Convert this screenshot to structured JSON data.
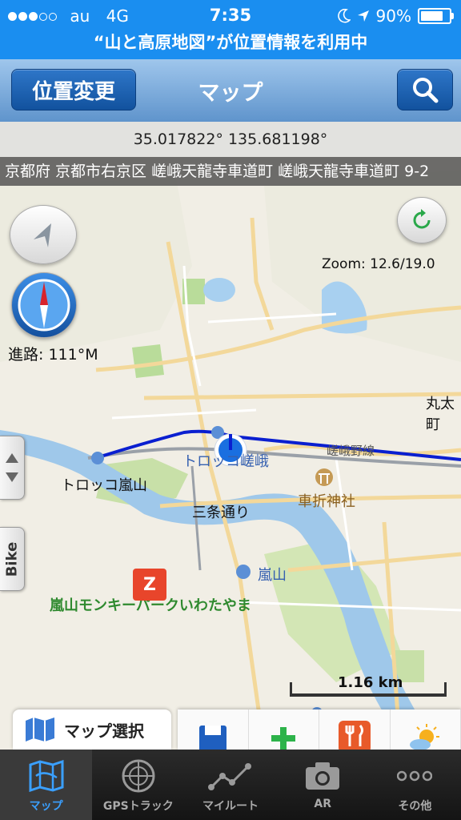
{
  "status": {
    "carrier": "au",
    "network": "4G",
    "time": "7:35",
    "battery": "90%",
    "battery_level": 0.9
  },
  "location_banner": "“山と高原地図”が位置情報を利用中",
  "navbar": {
    "left_button": "位置変更",
    "title": "マップ"
  },
  "map": {
    "coordinates": "35.017822° 135.681198°",
    "address": "京都府 京都市右京区 嵯峨天龍寺車道町 嵯峨天龍寺車道町 9-2",
    "zoom": "Zoom: 12.6/19.0",
    "heading": "進路: 111°M",
    "scale": "1.16 km",
    "places": {
      "torokko_arashiyama": "トロッコ嵐山",
      "torokko_saga": "トロッコ嵯峨",
      "kuruma_zaki": "車折神社",
      "sanjo": "三条通り",
      "arashiyama": "嵐山",
      "monkey_park": "嵐山モンキーパークいわたやま",
      "sagano_line": "嵯峨野線",
      "marutamachi": "丸太町"
    },
    "zoo_badge": "Z"
  },
  "side_tab": "Bike",
  "map_select": "マップ選択",
  "tabs": [
    {
      "label": "マップ",
      "icon": "map-icon",
      "active": true
    },
    {
      "label": "GPSトラック",
      "icon": "radar-icon",
      "active": false
    },
    {
      "label": "マイルート",
      "icon": "route-icon",
      "active": false
    },
    {
      "label": "AR",
      "icon": "camera-icon",
      "active": false
    },
    {
      "label": "その他",
      "icon": "more-icon",
      "active": false
    }
  ],
  "colors": {
    "accent": "#1a8ef0",
    "track": "#0a1fd0",
    "river": "#9fc8ea",
    "park": "#c8e0a8"
  }
}
